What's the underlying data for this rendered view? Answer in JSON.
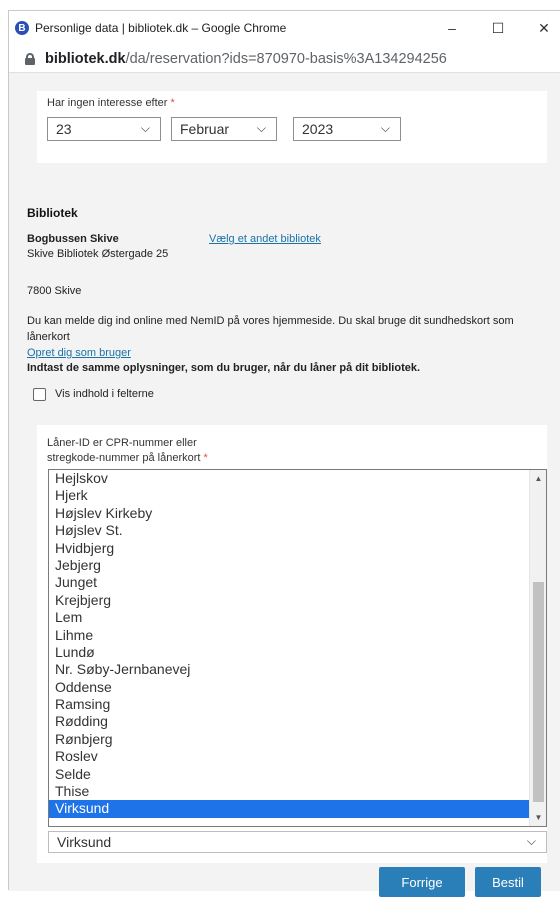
{
  "window": {
    "app_icon_letter": "B",
    "title": "Personlige data | bibliotek.dk – Google Chrome",
    "minimize": "–",
    "maximize": "☐",
    "close": "✕"
  },
  "address": {
    "host": "bibliotek.dk",
    "path": "/da/reservation?ids=870970-basis%3A134294256"
  },
  "interest": {
    "label": "Har ingen interesse efter",
    "required_mark": "*",
    "day": "23",
    "month": "Februar",
    "year": "2023"
  },
  "library": {
    "heading": "Bibliotek",
    "name": "Bogbussen Skive",
    "change_link": "Vælg et andet bibliotek",
    "address_line": "Skive Bibliotek Østergade 25",
    "postal": "7800 Skive",
    "info_text": "Du kan melde dig ind online med NemID på vores hjemmeside. Du skal bruge dit sundhedskort som lånerkort",
    "create_user_link": "Opret dig som bruger",
    "instructions": "Indtast de samme oplysninger, som du bruger, når du låner på dit bibliotek.",
    "show_content_label": "Vis indhold i felterne"
  },
  "loaner": {
    "label_line1": "Låner-ID er CPR-nummer eller",
    "label_line2": "stregkode-nummer på lånerkort",
    "required_mark": "*"
  },
  "dropdown": {
    "options": [
      "Hejlskov",
      "Hjerk",
      "Højslev Kirkeby",
      "Højslev St.",
      "Hvidbjerg",
      "Jebjerg",
      "Junget",
      "Krejbjerg",
      "Lem",
      "Lihme",
      "Lundø",
      "Nr. Søby-Jernbanevej",
      "Oddense",
      "Ramsing",
      "Rødding",
      "Rønbjerg",
      "Roslev",
      "Selde",
      "Thise",
      "Virksund"
    ],
    "selected": "Virksund"
  },
  "buttons": {
    "back": "Forrige",
    "order": "Bestil"
  },
  "colors": {
    "selection": "#1e73e8",
    "button": "#2b7fb8",
    "link": "#1a73a8"
  }
}
